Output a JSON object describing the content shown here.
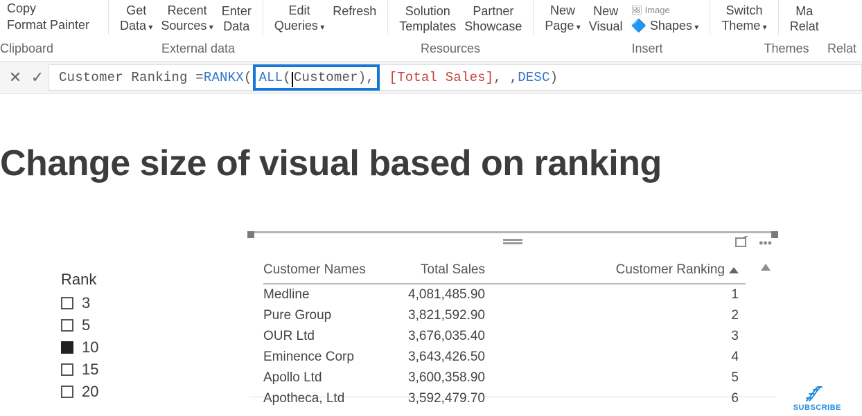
{
  "ribbon": {
    "copy": "Copy",
    "format_painter": "Format Painter",
    "get_data": "Get",
    "get_data2": "Data",
    "recent": "Recent",
    "recent2": "Sources",
    "enter": "Enter",
    "enter2": "Data",
    "edit": "Edit",
    "edit2": "Queries",
    "refresh": "Refresh",
    "solution": "Solution",
    "solution2": "Templates",
    "partner": "Partner",
    "partner2": "Showcase",
    "new_page": "New",
    "new_page2": "Page",
    "new_visual": "New",
    "new_visual2": "Visual",
    "image": "Image",
    "shapes": "Shapes",
    "switch": "Switch",
    "switch2": "Theme",
    "manage": "Ma",
    "manage2": "Relat",
    "labels": {
      "clipboard": "Clipboard",
      "external": "External data",
      "resources": "Resources",
      "insert": "Insert",
      "themes": "Themes",
      "relat": "Relat"
    }
  },
  "formula": {
    "lhs": "Customer Ranking = ",
    "fn": "RANKX",
    "open": "( ",
    "all": "ALL",
    "allparen_open": "(",
    "customer": " Customer ",
    "close_inner": "),",
    "measure": "[Total Sales]",
    "after_measure": ", , ",
    "desc": "DESC",
    "close": " )"
  },
  "report": {
    "title": "Change size of visual based on ranking",
    "slicer_title": "Rank",
    "slicer_options": [
      {
        "label": "3",
        "selected": false
      },
      {
        "label": "5",
        "selected": false
      },
      {
        "label": "10",
        "selected": true
      },
      {
        "label": "15",
        "selected": false
      },
      {
        "label": "20",
        "selected": false
      }
    ],
    "columns": {
      "name": "Customer Names",
      "sales": "Total Sales",
      "rank": "Customer Ranking"
    },
    "rows": [
      {
        "name": "Medline",
        "sales": "4,081,485.90",
        "rank": "1"
      },
      {
        "name": "Pure Group",
        "sales": "3,821,592.90",
        "rank": "2"
      },
      {
        "name": "OUR Ltd",
        "sales": "3,676,035.40",
        "rank": "3"
      },
      {
        "name": "Eminence Corp",
        "sales": "3,643,426.50",
        "rank": "4"
      },
      {
        "name": "Apollo Ltd",
        "sales": "3,600,358.90",
        "rank": "5"
      },
      {
        "name": "Apotheca, Ltd",
        "sales": "3,592,479.70",
        "rank": "6"
      }
    ]
  },
  "badge": {
    "subscribe": "SUBSCRIBE"
  }
}
